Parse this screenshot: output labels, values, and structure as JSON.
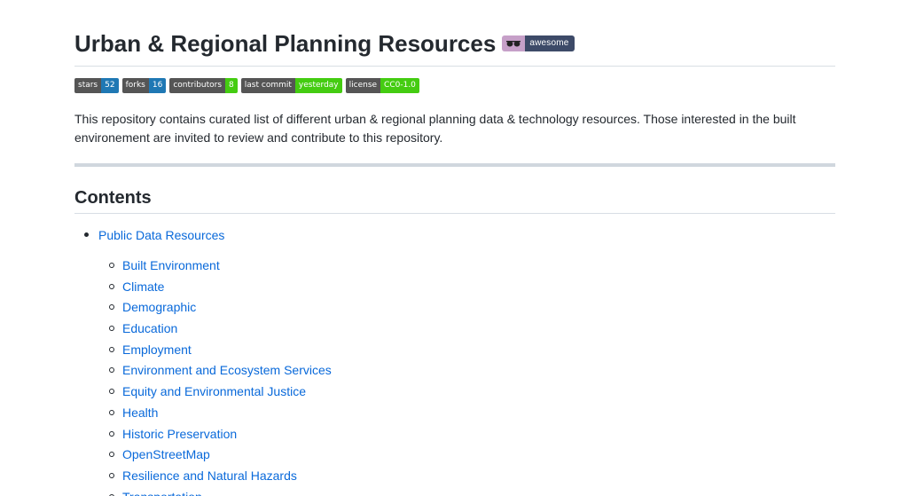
{
  "header": {
    "title": "Urban & Regional Planning Resources",
    "awesome_badge": {
      "icon": "sunglasses-icon",
      "label": "awesome",
      "colors": {
        "left": "#c6a0c8",
        "right": "#3d4a68"
      }
    }
  },
  "badges": [
    {
      "key": "stars",
      "value": "52",
      "color": "#1f78b4"
    },
    {
      "key": "forks",
      "value": "16",
      "color": "#1f78b4"
    },
    {
      "key": "contributors",
      "value": "8",
      "color": "#4c1"
    },
    {
      "key": "last commit",
      "value": "yesterday",
      "color": "#4c1"
    },
    {
      "key": "license",
      "value": "CC0-1.0",
      "color": "#4c1"
    }
  ],
  "description": "This repository contains curated list of different urban & regional planning data & technology resources. Those interested in the built environement are invited to review and contribute to this repository.",
  "contents": {
    "heading": "Contents",
    "items": [
      {
        "label": "Public Data Resources",
        "children": [
          "Built Environment",
          "Climate",
          "Demographic",
          "Education",
          "Employment",
          "Environment and Ecosystem Services",
          "Equity and Environmental Justice",
          "Health",
          "Historic Preservation",
          "OpenStreetMap",
          "Resilience and Natural Hazards",
          "Transportation"
        ]
      }
    ]
  },
  "colors": {
    "link": "#0969da",
    "text": "#24292f",
    "rule": "#d8dee4"
  }
}
